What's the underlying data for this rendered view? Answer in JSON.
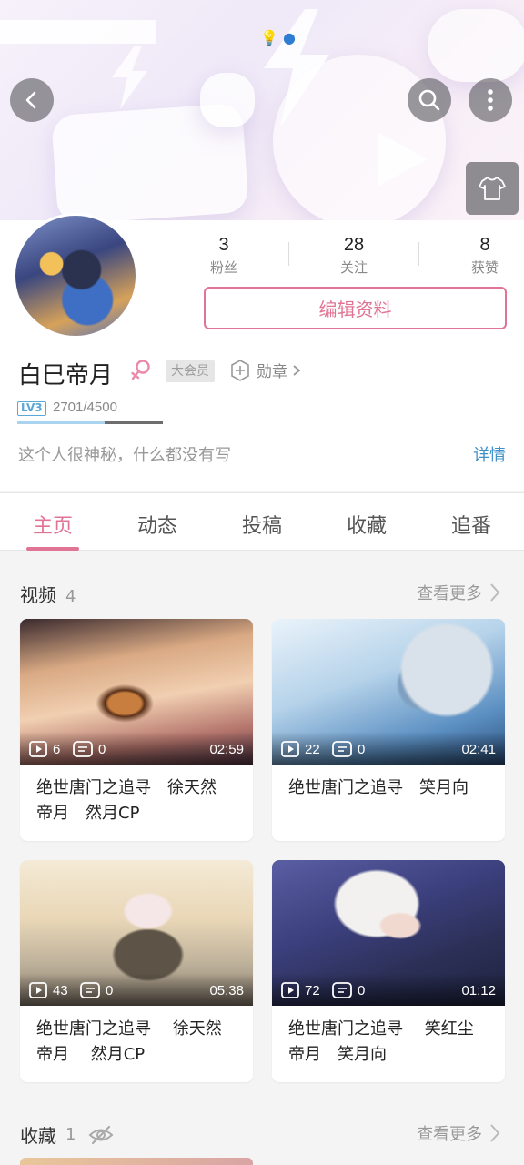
{
  "header": {
    "back_icon": "arrow-left-icon",
    "search_icon": "search-icon",
    "more_icon": "more-vertical-icon",
    "theme_icon": "shirt-icon"
  },
  "profile": {
    "stats": [
      {
        "value": "3",
        "label": "粉丝"
      },
      {
        "value": "28",
        "label": "关注"
      },
      {
        "value": "8",
        "label": "获赞"
      }
    ],
    "edit_button": "编辑资料",
    "name": "白巳帝月",
    "vip_badge": "大会员",
    "medal_label": "勋章",
    "level_badge": "LV3",
    "exp_text": "2701/4500",
    "exp_fraction": 0.6,
    "bio": "这个人很神秘，什么都没有写",
    "detail_link": "详情"
  },
  "tabs": [
    "主页",
    "动态",
    "投稿",
    "收藏",
    "追番"
  ],
  "active_tab": "主页",
  "videos_section": {
    "title": "视频",
    "count": "4",
    "more": "查看更多",
    "items": [
      {
        "plays": "6",
        "danmaku": "0",
        "duration": "02:59",
        "title": "绝世唐门之追寻　徐天然　帝月　然月CP"
      },
      {
        "plays": "22",
        "danmaku": "0",
        "duration": "02:41",
        "title": "绝世唐门之追寻　笑月向"
      },
      {
        "plays": "43",
        "danmaku": "0",
        "duration": "05:38",
        "title": "绝世唐门之追寻　 徐天然　 帝月　 然月CP"
      },
      {
        "plays": "72",
        "danmaku": "0",
        "duration": "01:12",
        "title": "绝世唐门之追寻　 笑红尘　帝月　笑月向"
      }
    ]
  },
  "favorites_section": {
    "title": "收藏",
    "count": "1",
    "more": "查看更多",
    "visibility_icon": "eye-off-icon"
  },
  "colors": {
    "accent": "#e07495",
    "link": "#3d90c8"
  }
}
